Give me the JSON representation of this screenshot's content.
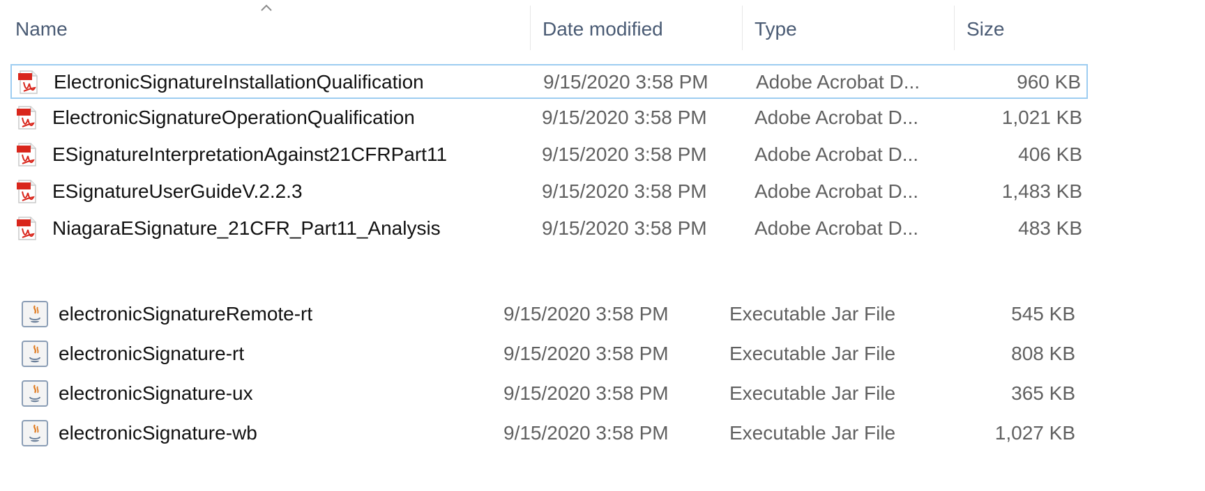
{
  "columns": {
    "name": "Name",
    "date_modified": "Date modified",
    "type": "Type",
    "size": "Size"
  },
  "sort": {
    "column": "Name",
    "icon": "sort-ascending-chevron-icon"
  },
  "pdf_files": [
    {
      "name": "ElectronicSignatureInstallationQualification",
      "date": "9/15/2020 3:58 PM",
      "type": "Adobe Acrobat D...",
      "size": "960 KB",
      "icon": "pdf-file-icon",
      "selected": true
    },
    {
      "name": "ElectronicSignatureOperationQualification",
      "date": "9/15/2020 3:58 PM",
      "type": "Adobe Acrobat D...",
      "size": "1,021 KB",
      "icon": "pdf-file-icon"
    },
    {
      "name": "ESignatureInterpretationAgainst21CFRPart11",
      "date": "9/15/2020 3:58 PM",
      "type": "Adobe Acrobat D...",
      "size": "406 KB",
      "icon": "pdf-file-icon"
    },
    {
      "name": "ESignatureUserGuideV.2.2.3",
      "date": "9/15/2020 3:58 PM",
      "type": "Adobe Acrobat D...",
      "size": "1,483 KB",
      "icon": "pdf-file-icon"
    },
    {
      "name": "NiagaraESignature_21CFR_Part11_Analysis",
      "date": "9/15/2020 3:58 PM",
      "type": "Adobe Acrobat D...",
      "size": "483 KB",
      "icon": "pdf-file-icon"
    }
  ],
  "jar_files": [
    {
      "name": "electronicSignatureRemote-rt",
      "date": "9/15/2020 3:58 PM",
      "type": "Executable Jar File",
      "size": "545 KB",
      "icon": "java-jar-file-icon"
    },
    {
      "name": "electronicSignature-rt",
      "date": "9/15/2020 3:58 PM",
      "type": "Executable Jar File",
      "size": "808 KB",
      "icon": "java-jar-file-icon"
    },
    {
      "name": "electronicSignature-ux",
      "date": "9/15/2020 3:58 PM",
      "type": "Executable Jar File",
      "size": "365 KB",
      "icon": "java-jar-file-icon"
    },
    {
      "name": "electronicSignature-wb",
      "date": "9/15/2020 3:58 PM",
      "type": "Executable Jar File",
      "size": "1,027 KB",
      "icon": "java-jar-file-icon"
    }
  ],
  "colors": {
    "header_text": "#4a5b74",
    "selection_border": "#9dcdf1",
    "secondary_text": "#606060",
    "pdf_red": "#d9261c"
  }
}
